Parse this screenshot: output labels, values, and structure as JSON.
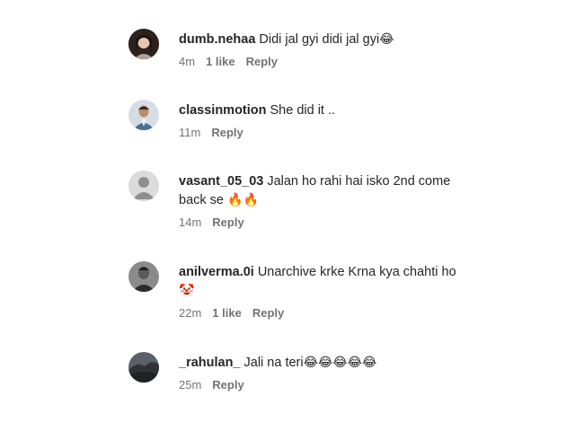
{
  "comments": [
    {
      "username": "dumb.nehaa",
      "text": "Didi jal gyi didi jal gyi",
      "emoji": "😂",
      "time": "4m",
      "likes": "1 like",
      "reply": "Reply",
      "avatar_colors": [
        "#3b2a26",
        "#e9c4b2"
      ]
    },
    {
      "username": "classinmotion",
      "text": "She did it ..",
      "emoji": "",
      "time": "11m",
      "likes": "",
      "reply": "Reply",
      "avatar_colors": [
        "#c9d2db",
        "#6a7a8a"
      ]
    },
    {
      "username": "vasant_05_03",
      "text": "Jalan ho rahi hai isko 2nd come back se",
      "emoji": "🔥🔥",
      "time": "14m",
      "likes": "",
      "reply": "Reply",
      "avatar_colors": [
        "#dbdbdb",
        "#8e8e8e"
      ]
    },
    {
      "username": "anilverma.0i",
      "text": "Unarchive krke Krna kya chahti ho",
      "emoji": "🤡",
      "time": "22m",
      "likes": "1 like",
      "reply": "Reply",
      "avatar_colors": [
        "#4a4a4a",
        "#a0a0a0"
      ]
    },
    {
      "username": "_rahulan_",
      "text": "Jali na teri",
      "emoji": "😂😂😂😂😂",
      "time": "25m",
      "likes": "",
      "reply": "Reply",
      "avatar_colors": [
        "#3a3f44",
        "#8c9299"
      ]
    }
  ]
}
